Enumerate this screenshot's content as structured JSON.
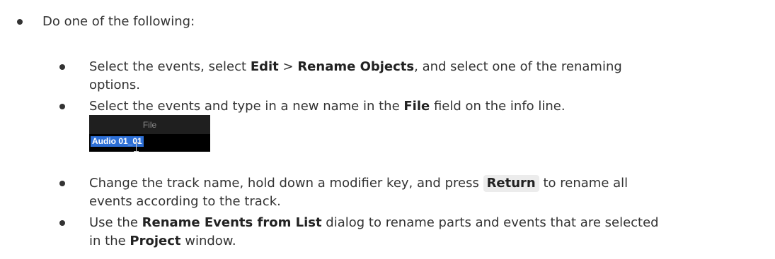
{
  "intro": "Do one of the following:",
  "items": [
    {
      "t1": "Select the events, select ",
      "b1": "Edit",
      "t2": " > ",
      "b2": "Rename Objects",
      "t3": ", and select one of the renaming",
      "line2": "options."
    },
    {
      "t1": "Select the events and type in a new name in the ",
      "b1": "File",
      "t2": " field on the info line."
    },
    {
      "t1": "Change the track name, hold down a modifier key, and press ",
      "key": "Return",
      "t2": " to rename all",
      "line2": "events according to the track."
    },
    {
      "t1": "Use the ",
      "b1": "Rename Events from List",
      "t2": " dialog to rename parts and events that are selected",
      "line2a": "in the ",
      "b2": "Project",
      "line2b": " window."
    }
  ],
  "info_line": {
    "header": "File",
    "value": "Audio 01_01"
  }
}
